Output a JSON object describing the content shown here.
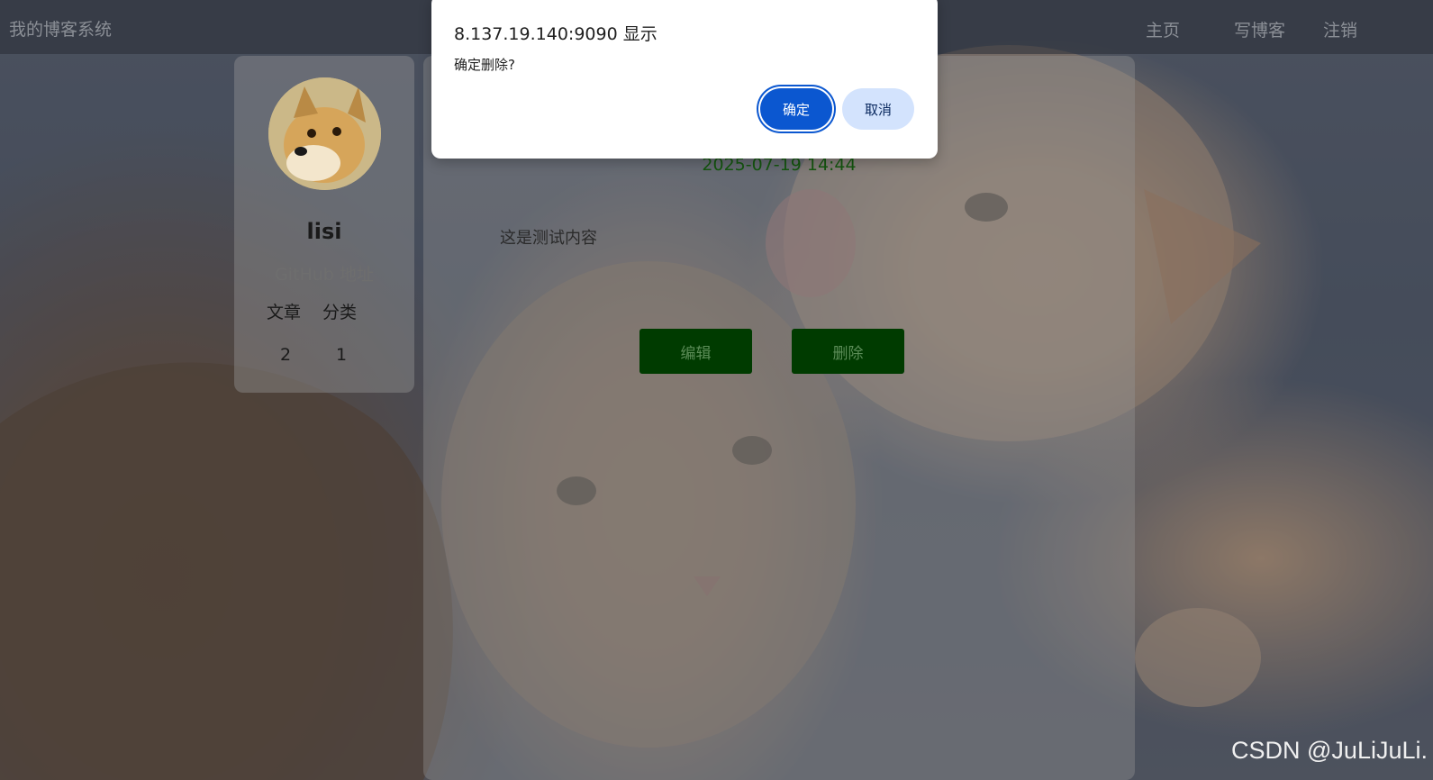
{
  "nav": {
    "title": "我的博客系统",
    "links": [
      "主页",
      "写博客",
      "注销"
    ]
  },
  "profile": {
    "username": "lisi",
    "github_label": "GitHub 地址",
    "stats_labels": [
      "文章",
      "分类"
    ],
    "stats_values": [
      "2",
      "1"
    ]
  },
  "post": {
    "date": "2025-07-19 14:44",
    "content": "这是测试内容",
    "edit_label": "编辑",
    "delete_label": "删除"
  },
  "dialog": {
    "title": "8.137.19.140:9090 显示",
    "message": "确定删除?",
    "ok_label": "确定",
    "cancel_label": "取消"
  },
  "watermark": "CSDN @JuLiJuLi.",
  "colors": {
    "nav_text": "#8b8f96",
    "date_green": "#14560f",
    "button_green": "#003b00",
    "dialog_ok": "#0b57d0",
    "dialog_cancel": "#d3e3fd"
  }
}
